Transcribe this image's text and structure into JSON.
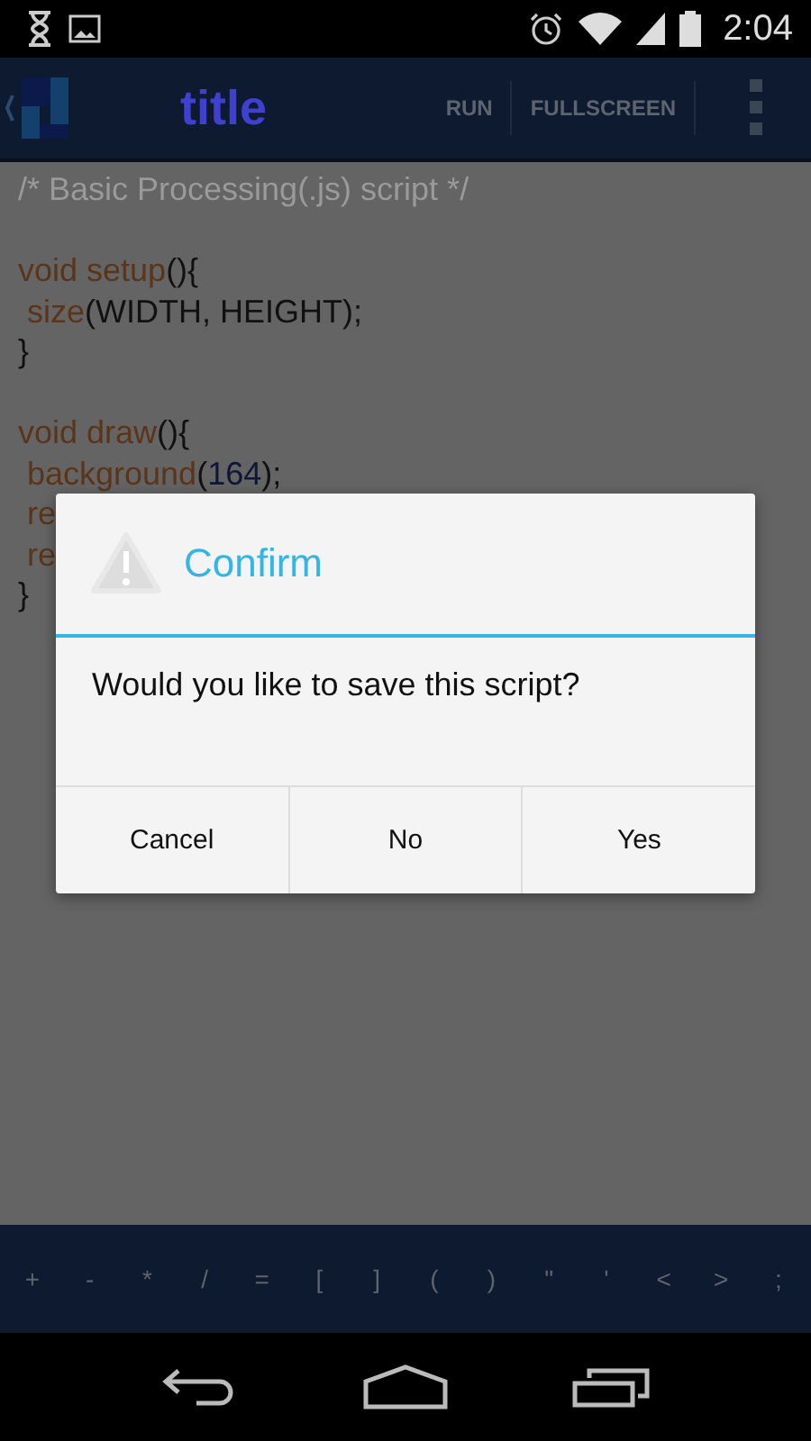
{
  "status_bar": {
    "time": "2:04"
  },
  "action_bar": {
    "title": "title",
    "actions": [
      "RUN",
      "FULLSCREEN"
    ]
  },
  "code_lines": [
    {
      "kind": "code",
      "tokens": [
        {
          "kind": "comment",
          "text": "/* Basic Processing(.js) script */"
        }
      ]
    },
    {
      "kind": "blank"
    },
    {
      "kind": "code",
      "tokens": [
        {
          "kind": "keyword",
          "text": "void setup"
        },
        {
          "kind": "plain",
          "text": "(){"
        }
      ]
    },
    {
      "kind": "code",
      "tokens": [
        {
          "kind": "keyword",
          "text": " size"
        },
        {
          "kind": "plain",
          "text": "(WIDTH, HEIGHT);"
        }
      ]
    },
    {
      "kind": "code",
      "tokens": [
        {
          "kind": "plain",
          "text": "}"
        }
      ]
    },
    {
      "kind": "blank"
    },
    {
      "kind": "code",
      "tokens": [
        {
          "kind": "keyword",
          "text": "void draw"
        },
        {
          "kind": "plain",
          "text": "(){"
        }
      ]
    },
    {
      "kind": "code",
      "tokens": [
        {
          "kind": "keyword",
          "text": " background"
        },
        {
          "kind": "plain",
          "text": "("
        },
        {
          "kind": "number",
          "text": "164"
        },
        {
          "kind": "plain",
          "text": ");"
        }
      ]
    },
    {
      "kind": "code",
      "tokens": [
        {
          "kind": "keyword",
          "text": " re"
        }
      ]
    },
    {
      "kind": "code",
      "tokens": [
        {
          "kind": "keyword",
          "text": " re"
        }
      ]
    },
    {
      "kind": "code",
      "tokens": [
        {
          "kind": "plain",
          "text": "}"
        }
      ]
    }
  ],
  "dialog": {
    "title": "Confirm",
    "message": "Would you like to save this script?",
    "buttons": [
      "Cancel",
      "No",
      "Yes"
    ]
  },
  "symbol_keys": [
    "+",
    "-",
    "*",
    "/",
    "=",
    "[",
    "]",
    "(",
    ")",
    "\"",
    "'",
    "<",
    ">",
    ";"
  ]
}
